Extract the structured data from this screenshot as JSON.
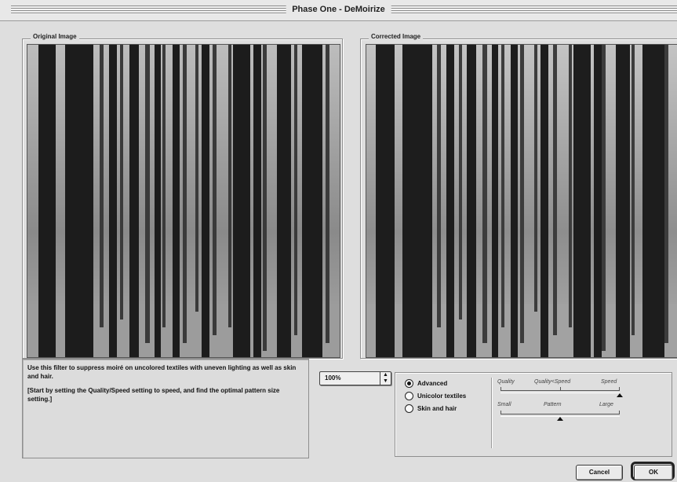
{
  "window": {
    "title": "Phase One - DeMoirize"
  },
  "original_panel": {
    "label": "Original Image"
  },
  "corrected_panel": {
    "label": "Corrected Image"
  },
  "description": {
    "line1": "Use this filter to suppress moiré on uncolored textiles with uneven lighting as well as skin and hair.",
    "line2": "[Start by setting the Quality/Speed setting to speed, and find the optimal pattern size setting.]"
  },
  "zoom": {
    "value": "100%",
    "arrow_icon": "up-down-arrows-icon"
  },
  "options": {
    "radios": [
      {
        "label": "Advanced",
        "selected": true
      },
      {
        "label": "Unicolor textiles",
        "selected": false
      },
      {
        "label": "Skin and hair",
        "selected": false
      }
    ],
    "quality_slider": {
      "left": "Quality",
      "middle": "Quality<Speed",
      "right": "Speed",
      "value_fraction": 1.0
    },
    "pattern_slider": {
      "left": "Small",
      "middle": "Pattern",
      "right": "Large",
      "value_fraction": 0.5
    }
  },
  "buttons": {
    "cancel": "Cancel",
    "ok": "OK"
  }
}
